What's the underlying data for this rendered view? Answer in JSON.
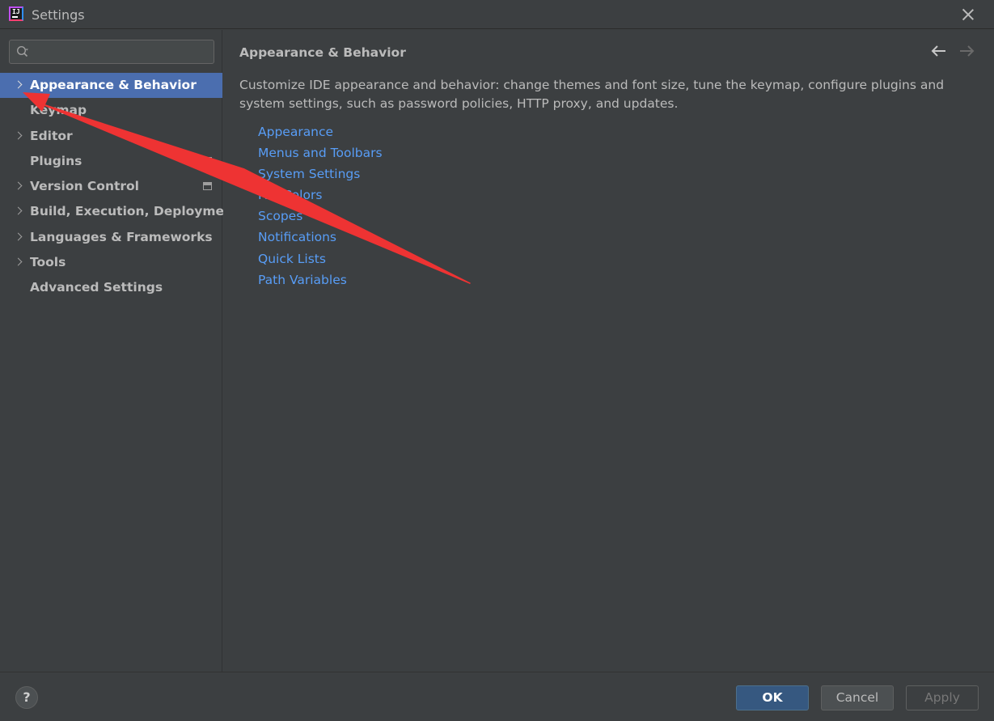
{
  "window": {
    "title": "Settings"
  },
  "search": {
    "placeholder": "",
    "value": ""
  },
  "sidebar": {
    "items": [
      {
        "label": "Appearance & Behavior",
        "expandable": true,
        "selected": true,
        "badge": false
      },
      {
        "label": "Keymap",
        "expandable": false,
        "selected": false,
        "badge": false
      },
      {
        "label": "Editor",
        "expandable": true,
        "selected": false,
        "badge": false
      },
      {
        "label": "Plugins",
        "expandable": false,
        "selected": false,
        "badge": true
      },
      {
        "label": "Version Control",
        "expandable": true,
        "selected": false,
        "badge": true
      },
      {
        "label": "Build, Execution, Deployment",
        "expandable": true,
        "selected": false,
        "badge": false
      },
      {
        "label": "Languages & Frameworks",
        "expandable": true,
        "selected": false,
        "badge": false
      },
      {
        "label": "Tools",
        "expandable": true,
        "selected": false,
        "badge": false
      },
      {
        "label": "Advanced Settings",
        "expandable": false,
        "selected": false,
        "badge": false
      }
    ]
  },
  "main": {
    "title": "Appearance & Behavior",
    "description": "Customize IDE appearance and behavior: change themes and font size, tune the keymap, configure plugins and system settings, such as password policies, HTTP proxy, and updates.",
    "links": [
      "Appearance",
      "Menus and Toolbars",
      "System Settings",
      "File Colors",
      "Scopes",
      "Notifications",
      "Quick Lists",
      "Path Variables"
    ]
  },
  "footer": {
    "help_label": "?",
    "ok_label": "OK",
    "cancel_label": "Cancel",
    "apply_label": "Apply"
  },
  "colors": {
    "background": "#3c3f41",
    "selection": "#4b6eaf",
    "link": "#589df6",
    "annotation_arrow": "#ee3333"
  }
}
